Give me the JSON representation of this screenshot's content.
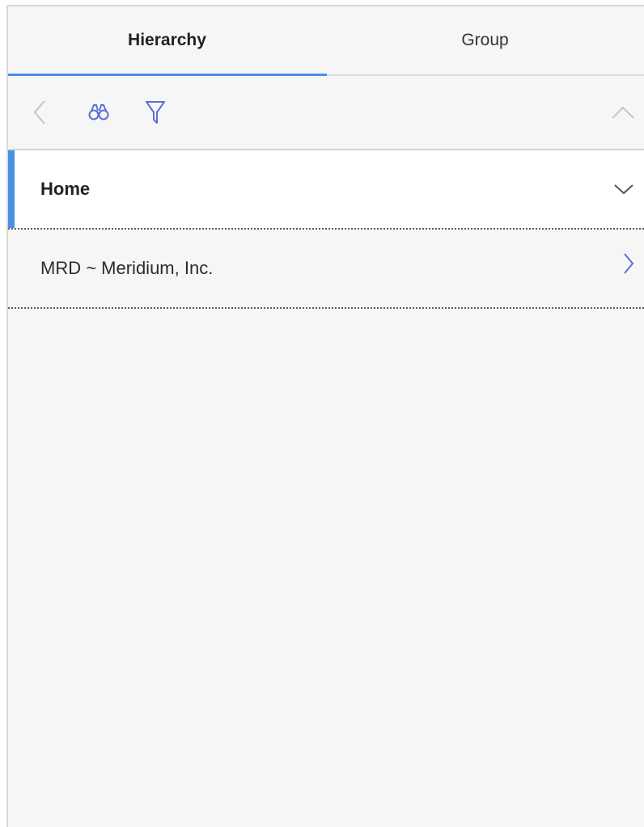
{
  "tabs": [
    {
      "label": "Hierarchy",
      "active": true
    },
    {
      "label": "Group",
      "active": false
    }
  ],
  "toolbar": {
    "back_icon": "chevron-left-icon",
    "search_icon": "binoculars-icon",
    "filter_icon": "funnel-icon",
    "collapse_icon": "chevron-up-icon"
  },
  "list": {
    "items": [
      {
        "label": "Home",
        "selected": true,
        "chevron": "chevron-down-icon"
      },
      {
        "label": "MRD ~ Meridium, Inc.",
        "selected": false,
        "chevron": "chevron-right-icon"
      }
    ]
  },
  "colors": {
    "accent": "#4a90e2",
    "icon_blue": "#5a6fd6",
    "icon_gray": "#bdbdbd",
    "background": "#f6f6f6"
  }
}
